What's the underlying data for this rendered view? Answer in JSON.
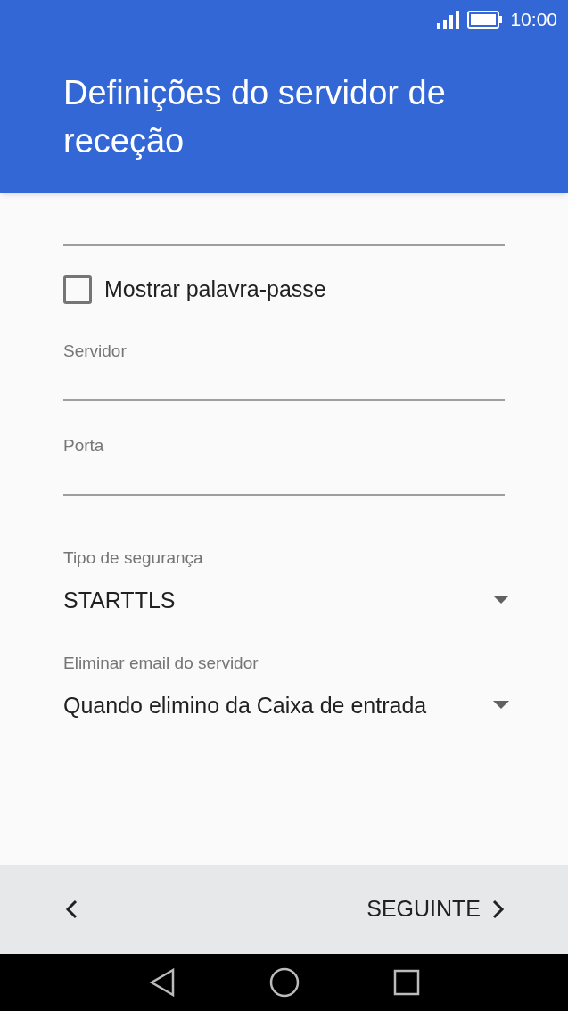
{
  "status_bar": {
    "time": "10:00"
  },
  "header": {
    "title": "Definições do servidor de receção"
  },
  "checkbox": {
    "label": "Mostrar palavra-passe",
    "checked": false
  },
  "text_fields": [
    {
      "label": "Servidor"
    },
    {
      "label": "Porta"
    }
  ],
  "dropdowns": [
    {
      "label": "Tipo de segurança",
      "value": "STARTTLS"
    },
    {
      "label": "Eliminar email do servidor",
      "value": "Quando elimino da Caixa de entrada"
    }
  ],
  "footer": {
    "next": "SEGUINTE"
  }
}
